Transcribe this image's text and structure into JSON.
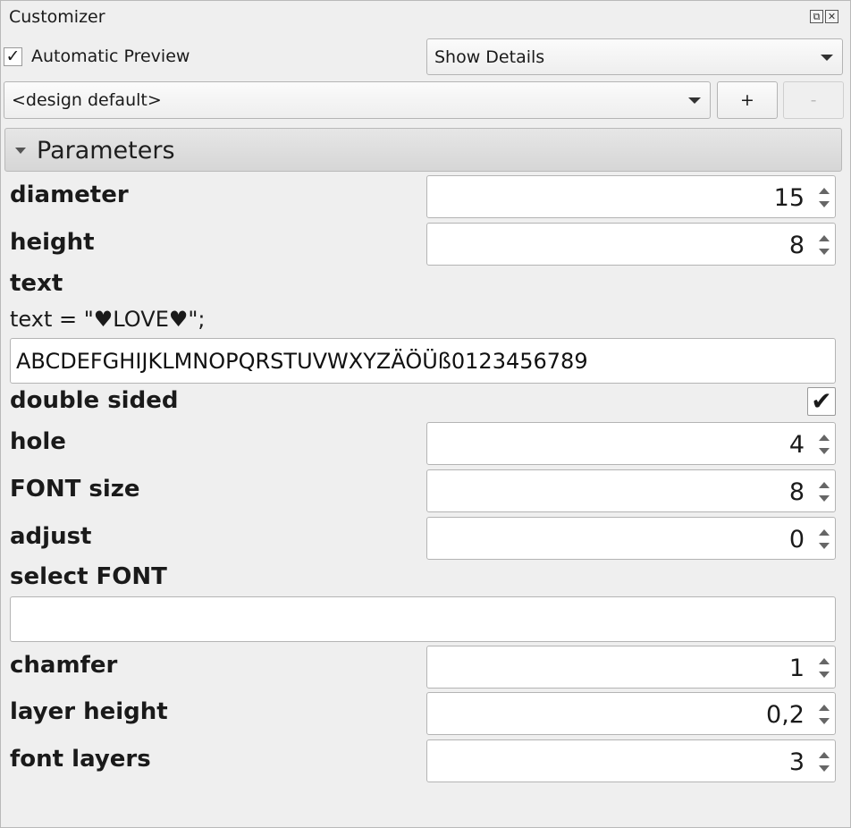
{
  "window": {
    "title": "Customizer"
  },
  "top": {
    "auto_preview_label": "Automatic Preview",
    "auto_preview_checked": true,
    "details_value": "Show Details",
    "preset_value": "<design default>",
    "add_label": "+",
    "remove_label": "-"
  },
  "section": {
    "label": "Parameters"
  },
  "params": {
    "diameter": {
      "label": "diameter",
      "value": "15"
    },
    "height": {
      "label": "height",
      "value": "8"
    },
    "text": {
      "label": "text",
      "desc": "text = \"♥LOVE♥\";",
      "value": "ABCDEFGHIJKLMNOPQRSTUVWXYZÄÖÜß0123456789"
    },
    "double_sided": {
      "label": "double sided",
      "checked": true
    },
    "hole": {
      "label": "hole",
      "value": "4"
    },
    "font_size": {
      "label": "FONT size",
      "value": "8"
    },
    "adjust": {
      "label": "adjust",
      "value": "0"
    },
    "select_font": {
      "label": "select FONT",
      "value": ""
    },
    "chamfer": {
      "label": "chamfer",
      "value": "1"
    },
    "layer_height": {
      "label": "layer height",
      "value": "0,2"
    },
    "font_layers": {
      "label": "font layers",
      "value": "3"
    }
  },
  "icons": {
    "check": "✓",
    "heavy_check": "✔"
  }
}
